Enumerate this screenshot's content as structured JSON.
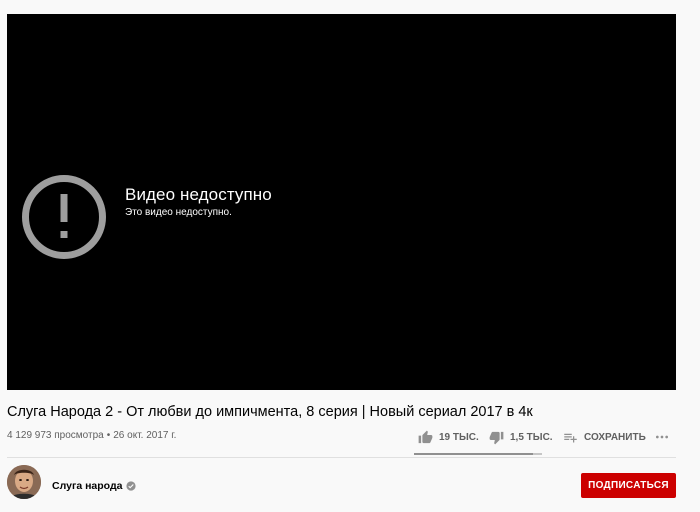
{
  "player": {
    "error_title": "Видео недоступно",
    "error_subtitle": "Это видео недоступно."
  },
  "video": {
    "title": "Слуга Народа 2 - От любви до импичмента, 8 серия | Новый сериал 2017 в 4к",
    "views": "4 129 973 просмотра",
    "separator": "•",
    "date": "26 окт. 2017 г."
  },
  "actions": {
    "likes": "19 ТЫС.",
    "dislikes": "1,5 ТЫС.",
    "save_label": "СОХРАНИТЬ",
    "like_ratio": 0.93
  },
  "channel": {
    "name": "Слуга народа",
    "verified": true
  },
  "subscribe": {
    "label": "ПОДПИСАТЬСЯ"
  },
  "colors": {
    "subscribe_bg": "#cc0000",
    "player_bg": "#000000",
    "page_bg": "#f9f9f9"
  },
  "icons": [
    "alert-circle-icon",
    "thumb-up-icon",
    "thumb-down-icon",
    "playlist-add-icon",
    "more-horiz-icon",
    "verified-check-icon"
  ]
}
